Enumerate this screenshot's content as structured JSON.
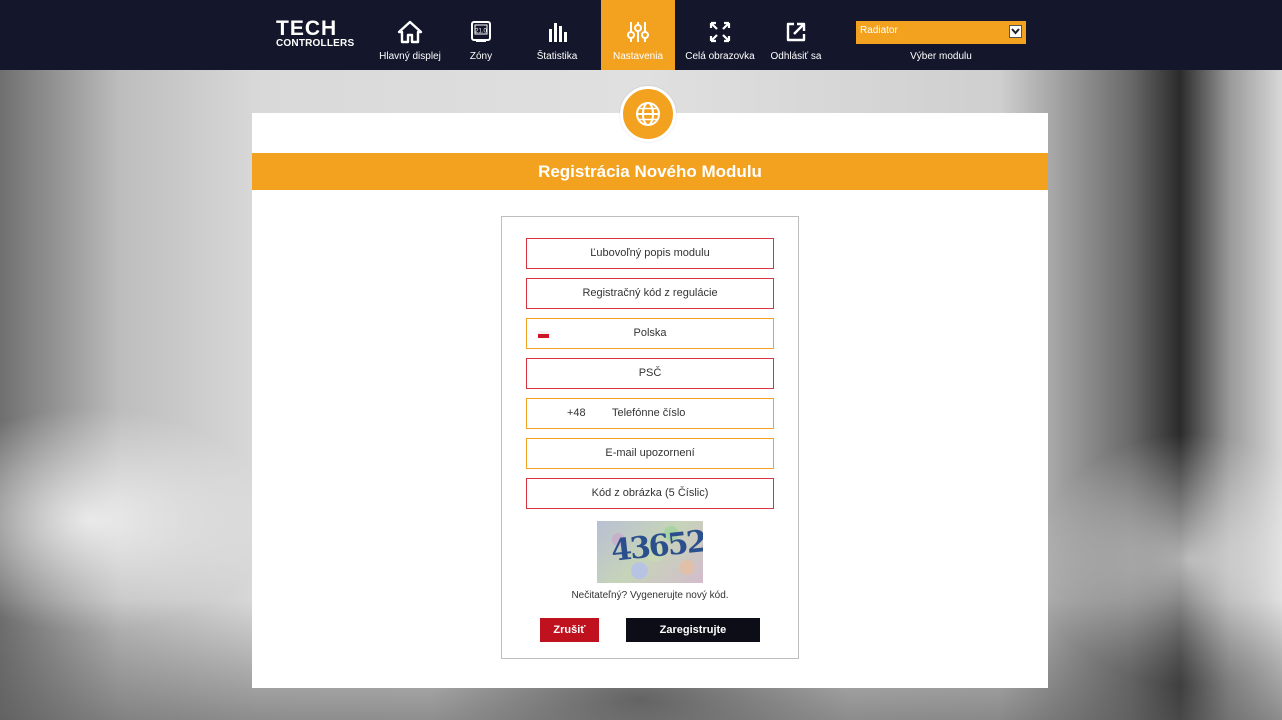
{
  "logo": {
    "main": "TECH",
    "sub": "CONTROLLERS"
  },
  "nav": [
    {
      "label": "Hlavný displej",
      "icon": "home-icon"
    },
    {
      "label": "Zóny",
      "icon": "thermostat-icon",
      "icon_text": "21.0"
    },
    {
      "label": "Štatistika",
      "icon": "bar-chart-icon"
    },
    {
      "label": "Nastavenia",
      "icon": "sliders-icon",
      "active": true
    },
    {
      "label": "Celá obrazovka",
      "icon": "fullscreen-icon"
    },
    {
      "label": "Odhlásiť sa",
      "icon": "logout-icon"
    }
  ],
  "module_select": {
    "value": "Radiator",
    "label": "Výber modulu"
  },
  "dialog": {
    "icon": "globe-icon",
    "title": "Registrácia Nového Modulu",
    "fields": {
      "description": "Ľubovoľný popis modulu",
      "reg_code": "Registračný kód z regulácie",
      "country": "Polska",
      "postcode": "PSČ",
      "phone_prefix": "+48",
      "phone": "Telefónne číslo",
      "email": "E-mail upozornení",
      "captcha_code": "Kód z obrázka (5 Číslic)"
    },
    "captcha_text": "43652",
    "captcha_hint": "Nečitateľný? Vygenerujte nový kód.",
    "cancel_label": "Zrušiť",
    "register_label": "Zaregistrujte"
  },
  "colors": {
    "topbar": "#14172b",
    "accent": "#f3a21f",
    "required_border": "#d8343f",
    "cancel": "#c0111f",
    "register": "#0c0d17"
  }
}
